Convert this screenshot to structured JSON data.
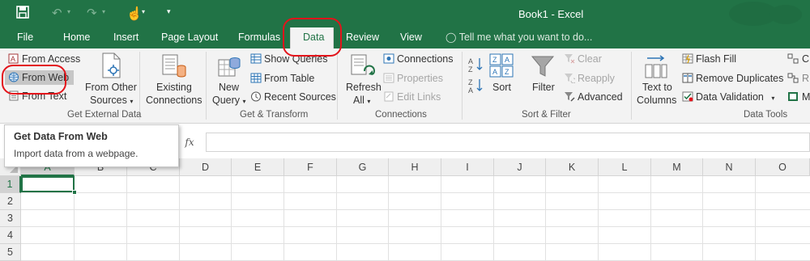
{
  "title": "Book1 - Excel",
  "tabs": [
    "File",
    "Home",
    "Insert",
    "Page Layout",
    "Formulas",
    "Data",
    "Review",
    "View"
  ],
  "tell_me": "Tell me what you want to do...",
  "ribbon": {
    "get_external": {
      "from_access": "From Access",
      "from_web": "From Web",
      "from_text": "From Text",
      "from_other_1": "From Other",
      "from_other_2": "Sources",
      "existing_1": "Existing",
      "existing_2": "Connections",
      "label": "Get External Data"
    },
    "get_transform": {
      "new_query_1": "New",
      "new_query_2": "Query",
      "show_queries": "Show Queries",
      "from_table": "From Table",
      "recent_sources": "Recent Sources",
      "label": "Get & Transform"
    },
    "connections": {
      "refresh_1": "Refresh",
      "refresh_2": "All",
      "connections": "Connections",
      "properties": "Properties",
      "edit_links": "Edit Links",
      "label": "Connections"
    },
    "sort_filter": {
      "sort": "Sort",
      "filter": "Filter",
      "clear": "Clear",
      "reapply": "Reapply",
      "advanced": "Advanced",
      "label": "Sort & Filter"
    },
    "data_tools": {
      "text_to_1": "Text to",
      "text_to_2": "Columns",
      "flash_fill": "Flash Fill",
      "remove_duplicates": "Remove Duplicates",
      "data_validation": "Data Validation",
      "label": "Data Tools"
    }
  },
  "tooltip": {
    "title": "Get Data From Web",
    "description": "Import data from a webpage."
  },
  "formula_bar": {
    "fx": "fx"
  },
  "columns": [
    "A",
    "B",
    "C",
    "D",
    "E",
    "F",
    "G",
    "H",
    "I",
    "J",
    "K",
    "L",
    "M",
    "N",
    "O"
  ],
  "rows": [
    "1",
    "2",
    "3",
    "4",
    "5"
  ],
  "colors": {
    "excel_green": "#217346",
    "annotation_red": "#e3141b"
  }
}
